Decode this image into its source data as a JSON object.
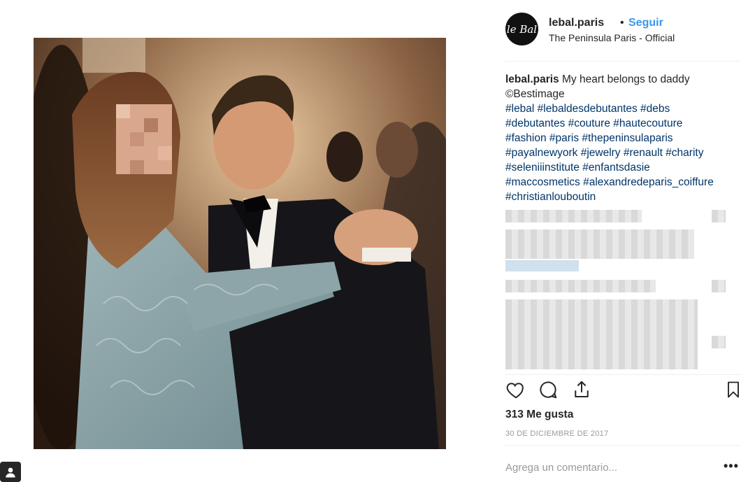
{
  "post": {
    "username": "lebal.paris",
    "separator": "•",
    "follow_label": "Seguir",
    "location": "The Peninsula Paris - Official",
    "avatar_text": "le Bal",
    "caption": {
      "username": "lebal.paris",
      "text": "My heart belongs to daddy",
      "credit": "©Bestimage",
      "hashtags": [
        "#lebal #lebaldesdebutantes #debs",
        "#debutantes #couture #hautecouture",
        "#fashion #paris #thepeninsulaparis",
        "#payalnewyork #jewelry #renault #charity",
        "#seleniiinstitute #enfantsdasie",
        "#maccosmetics #alexandredeparis_coiffure",
        "#christianlouboutin"
      ]
    },
    "likes": "313 Me gusta",
    "date": "30 DE DICIEMBRE DE 2017",
    "comment_placeholder": "Agrega un comentario...",
    "more_label": "•••"
  },
  "icons": {
    "like": "heart-icon",
    "comment": "comment-icon",
    "share": "share-icon",
    "save": "bookmark-icon",
    "profile": "user-icon"
  },
  "colors": {
    "link_blue": "#3897f0",
    "hashtag": "#003569",
    "text": "#262626",
    "muted": "#999999"
  }
}
